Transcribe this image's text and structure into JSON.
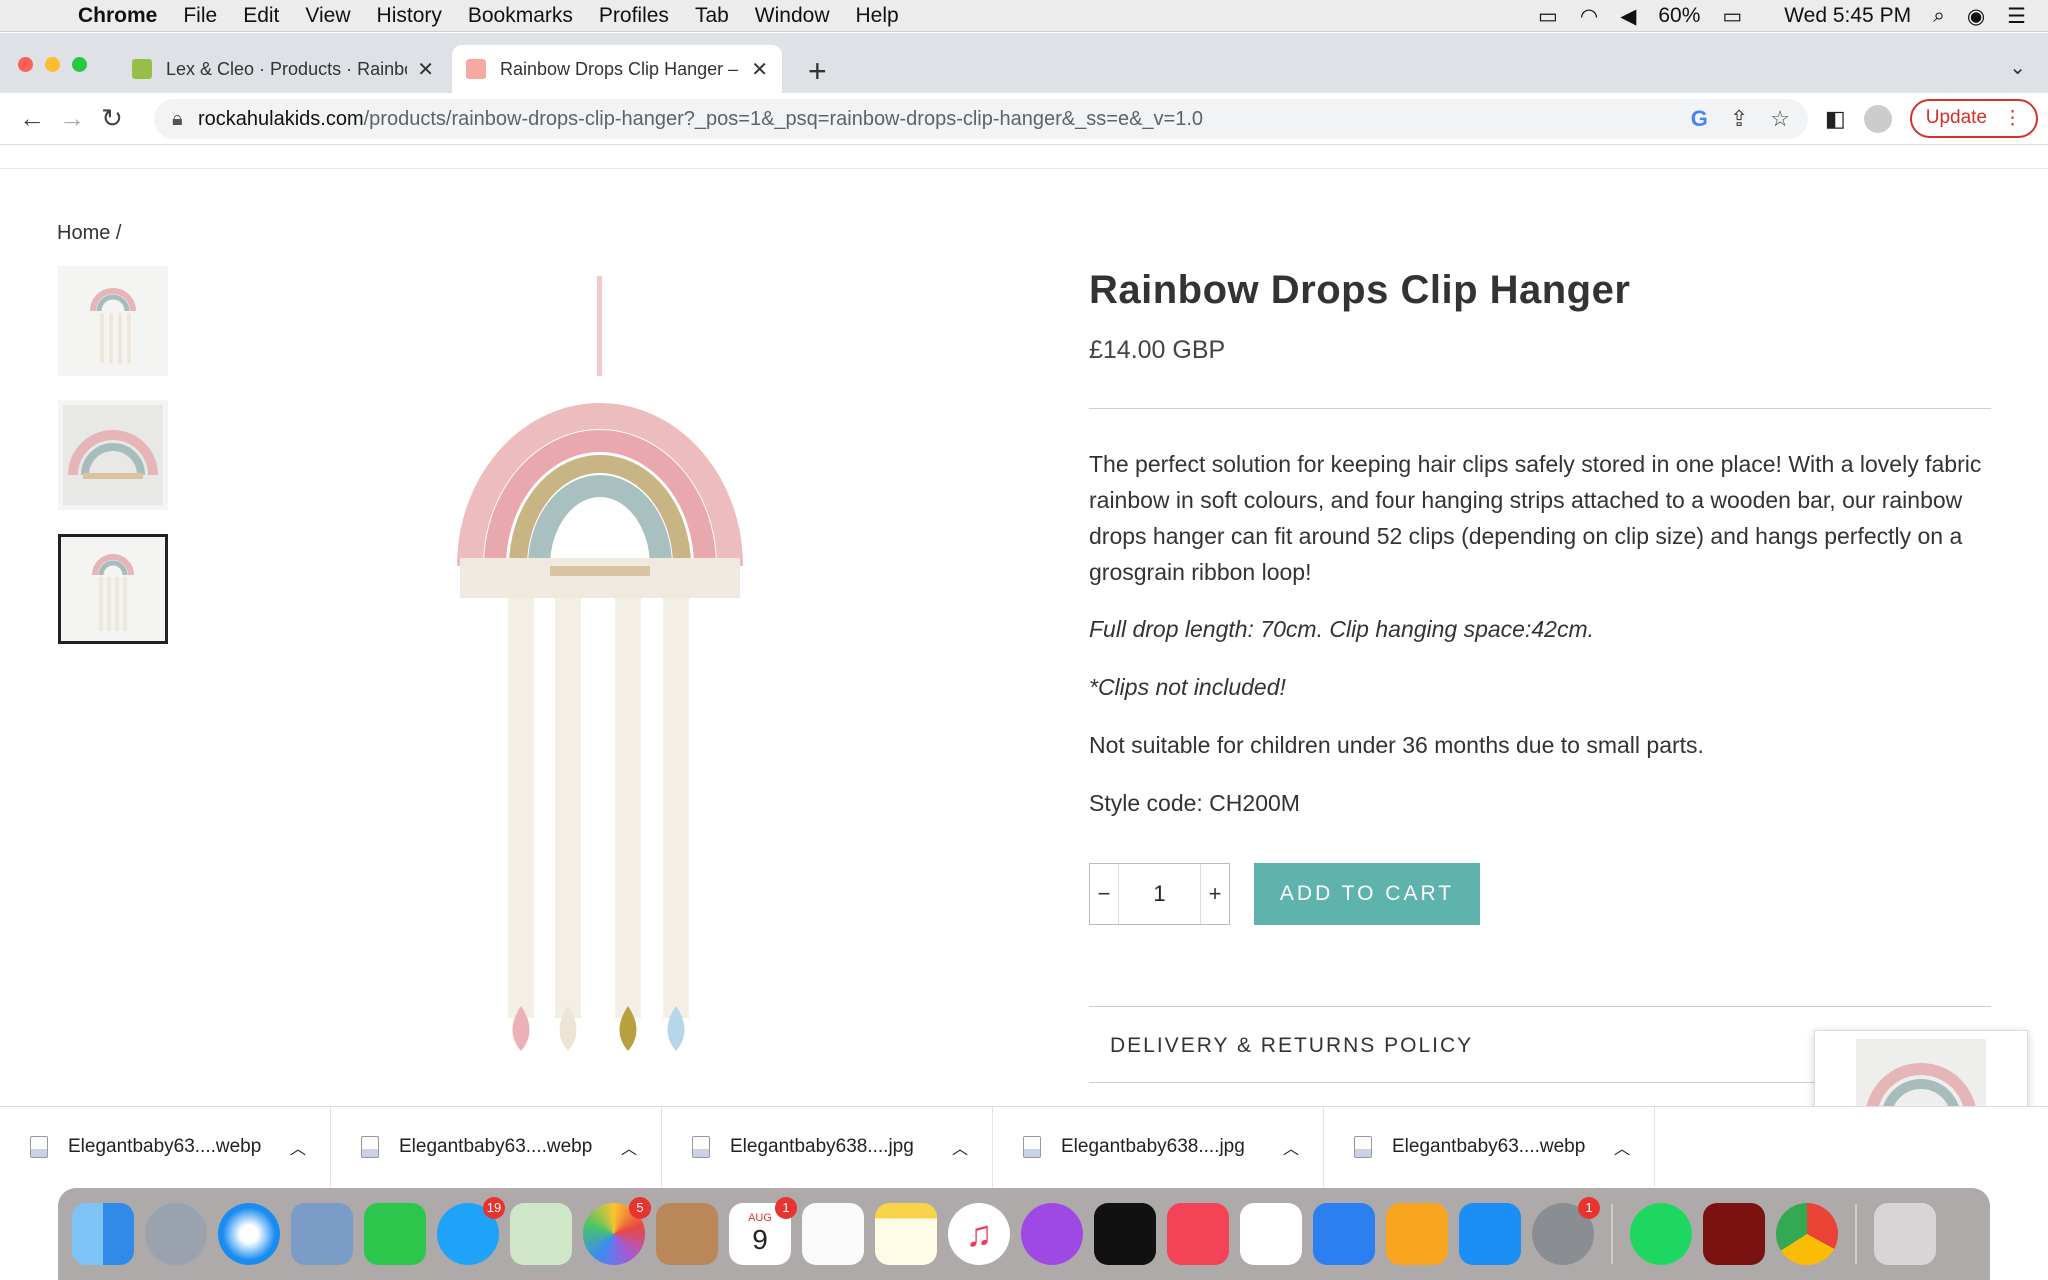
{
  "menubar": {
    "apple_icon": "apple-icon",
    "app": "Chrome",
    "items": [
      "File",
      "Edit",
      "View",
      "History",
      "Bookmarks",
      "Profiles",
      "Tab",
      "Window",
      "Help"
    ],
    "battery": "60%",
    "clock": "Wed 5:45 PM"
  },
  "tabs": [
    {
      "title": "Lex & Cleo · Products · Rainbow",
      "close": "✕"
    },
    {
      "title": "Rainbow Drops Clip Hanger – R",
      "close": "✕"
    }
  ],
  "new_tab": "+",
  "address": {
    "host": "rockahulakids.com",
    "path": "/products/rainbow-drops-clip-hanger?_pos=1&_psq=rainbow-drops-clip-hanger&_ss=e&_v=1.0"
  },
  "update_label": "Update",
  "breadcrumb": "Home /",
  "product": {
    "title": "Rainbow Drops Clip Hanger",
    "price": "£14.00 GBP",
    "description": "The perfect solution for keeping hair clips safely stored in one place! With a lovely fabric rainbow in soft colours, and four hanging strips attached to a wooden bar, our rainbow drops hanger can fit around 52 clips (depending on clip size) and hangs perfectly on a grosgrain ribbon loop!",
    "dimensions": "Full drop length: 70cm. Clip hanging space:42cm.",
    "clips_note": "*Clips not included!",
    "warning": "Not suitable for children under 36 months due to small parts.",
    "style_code": "Style code: CH200M",
    "quantity": "1",
    "minus": "−",
    "plus": "+",
    "add_to_cart": "ADD TO CART",
    "accordion": "DELIVERY & RETURNS POLICY"
  },
  "downloads": [
    {
      "name": "Elegantbaby63....webp"
    },
    {
      "name": "Elegantbaby63....webp"
    },
    {
      "name": "Elegantbaby638....jpg"
    },
    {
      "name": "Elegantbaby638....jpg"
    },
    {
      "name": "Elegantbaby63....webp"
    }
  ],
  "dock_badges": {
    "messages": "19",
    "photos": "5",
    "calendar": "1",
    "calendar_month": "AUG",
    "calendar_day": "9",
    "settings": "1"
  },
  "colors": {
    "accent": "#5fb3ad",
    "update": "#d93025"
  }
}
